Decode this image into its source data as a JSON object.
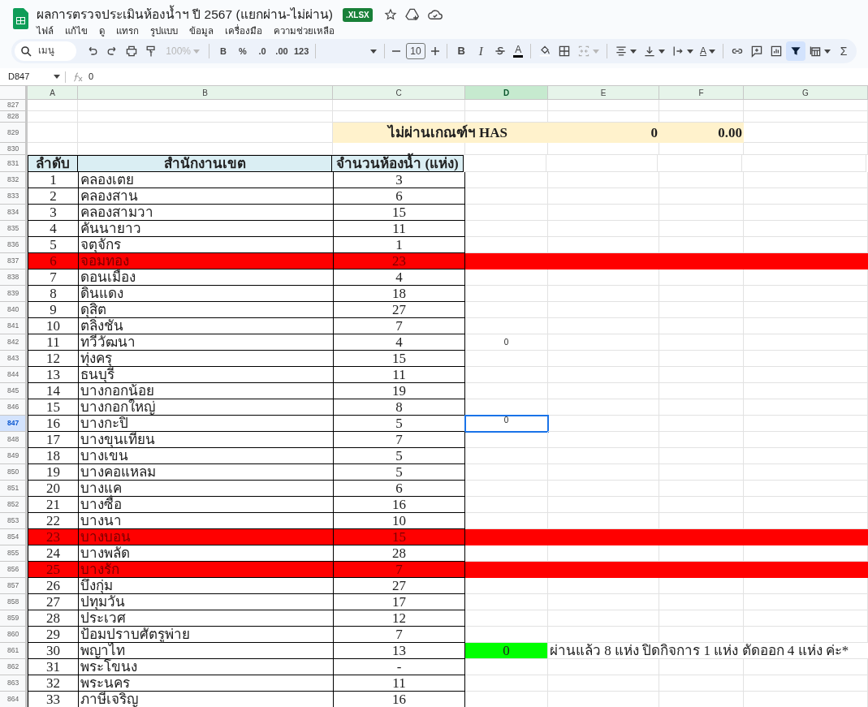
{
  "document": {
    "title": "ผลการตรวจประเมินห้องน้ำฯ ปี 2567 (แยกผ่าน-ไม่ผ่าน)",
    "badge": ".XLSX"
  },
  "menu": [
    "ไฟล์",
    "แก้ไข",
    "ดู",
    "แทรก",
    "รูปแบบ",
    "ข้อมูล",
    "เครื่องมือ",
    "ความช่วยเหลือ"
  ],
  "toolbar": [
    {
      "kind": "search",
      "label": "เมนู"
    },
    {
      "kind": "undo"
    },
    {
      "kind": "redo"
    },
    {
      "kind": "print"
    },
    {
      "kind": "paint_format"
    },
    {
      "kind": "zoom",
      "label": "100%",
      "disabled": true
    },
    {
      "kind": "sep"
    },
    {
      "kind": "text",
      "label": "B",
      "disabled": false
    },
    {
      "kind": "text",
      "label": "%",
      "disabled": false
    },
    {
      "kind": "text",
      "label": ".0",
      "disabled": false
    },
    {
      "kind": "text",
      "label": ".00",
      "disabled": false
    },
    {
      "kind": "text",
      "label": "123",
      "disabled": false
    },
    {
      "kind": "sep"
    },
    {
      "kind": "font"
    },
    {
      "kind": "sep"
    },
    {
      "kind": "minus"
    },
    {
      "kind": "font_size",
      "label": "10"
    },
    {
      "kind": "plus"
    },
    {
      "kind": "sep"
    },
    {
      "kind": "bold",
      "label": "B"
    },
    {
      "kind": "italic",
      "label": "I"
    },
    {
      "kind": "strike"
    },
    {
      "kind": "text_color",
      "label": "A"
    },
    {
      "kind": "sep"
    },
    {
      "kind": "fill"
    },
    {
      "kind": "borders"
    },
    {
      "kind": "merge",
      "disabled": true
    },
    {
      "kind": "sep"
    },
    {
      "kind": "align"
    },
    {
      "kind": "valign"
    },
    {
      "kind": "wrap"
    },
    {
      "kind": "rotate",
      "label": "A"
    },
    {
      "kind": "sep"
    },
    {
      "kind": "link"
    },
    {
      "kind": "comment"
    },
    {
      "kind": "chart"
    },
    {
      "kind": "filter",
      "selected": true
    },
    {
      "kind": "filter_views"
    },
    {
      "kind": "functions",
      "label": "Σ"
    }
  ],
  "formula_bar": {
    "cell": "D847",
    "value": "0"
  },
  "columns": [
    {
      "label": "A",
      "selected": false
    },
    {
      "label": "B",
      "selected": false
    },
    {
      "label": "C",
      "selected": false
    },
    {
      "label": "D",
      "selected": true
    },
    {
      "label": "E",
      "selected": false
    },
    {
      "label": "F",
      "selected": false
    },
    {
      "label": "G",
      "selected": false
    }
  ],
  "rows": [
    {
      "number": "827",
      "kind": "blank",
      "selected": false
    },
    {
      "number": "828",
      "kind": "blank",
      "selected": false
    },
    {
      "number": "829",
      "kind": "summary",
      "label": "ไม่ผ่านเกณฑ์ฯ HAS",
      "value": "0",
      "ratio": "0.00",
      "selected": false
    },
    {
      "number": "830",
      "kind": "blank",
      "selected": false
    },
    {
      "number": "831",
      "kind": "header",
      "cells": [
        "ลำดับ",
        "สำนักงานเขต",
        "จำนวนห้องน้ำ (แห่ง)"
      ],
      "selected": false
    },
    {
      "number": "832",
      "kind": "data",
      "order": "1",
      "name": "คลองเตย",
      "count": "3",
      "flagged": false,
      "selected": false
    },
    {
      "number": "833",
      "kind": "data",
      "order": "2",
      "name": "คลองสาน",
      "count": "6",
      "flagged": false,
      "selected": false
    },
    {
      "number": "834",
      "kind": "data",
      "order": "3",
      "name": "คลองสามวา",
      "count": "15",
      "flagged": false,
      "selected": false
    },
    {
      "number": "835",
      "kind": "data",
      "order": "4",
      "name": "คันนายาว",
      "count": "11",
      "flagged": false,
      "selected": false
    },
    {
      "number": "836",
      "kind": "data",
      "order": "5",
      "name": "จตุจักร",
      "count": "1",
      "flagged": false,
      "selected": false
    },
    {
      "number": "837",
      "kind": "data",
      "order": "6",
      "name": "จอมทอง",
      "count": "23",
      "flagged": true,
      "selected": false
    },
    {
      "number": "838",
      "kind": "data",
      "order": "7",
      "name": "ดอนเมือง",
      "count": "4",
      "flagged": false,
      "selected": false
    },
    {
      "number": "839",
      "kind": "data",
      "order": "8",
      "name": "ดินแดง",
      "count": "18",
      "flagged": false,
      "selected": false
    },
    {
      "number": "840",
      "kind": "data",
      "order": "9",
      "name": "ดุสิต",
      "count": "27",
      "flagged": false,
      "selected": false
    },
    {
      "number": "841",
      "kind": "data",
      "order": "10",
      "name": "ตลิ่งชัน",
      "count": "7",
      "flagged": false,
      "selected": false
    },
    {
      "number": "842",
      "kind": "data",
      "order": "11",
      "name": "ทวีวัฒนา",
      "count": "4",
      "flagged": false,
      "selected": false,
      "d": {
        "value": "0"
      }
    },
    {
      "number": "843",
      "kind": "data",
      "order": "12",
      "name": "ทุ่งครุ",
      "count": "15",
      "flagged": false,
      "selected": false
    },
    {
      "number": "844",
      "kind": "data",
      "order": "13",
      "name": "ธนบุรี",
      "count": "11",
      "flagged": false,
      "selected": false
    },
    {
      "number": "845",
      "kind": "data",
      "order": "14",
      "name": "บางกอกน้อย",
      "count": "19",
      "flagged": false,
      "selected": false
    },
    {
      "number": "846",
      "kind": "data",
      "order": "15",
      "name": "บางกอกใหญ่",
      "count": "8",
      "flagged": false,
      "selected": false
    },
    {
      "number": "847",
      "kind": "data",
      "order": "16",
      "name": "บางกะปิ",
      "count": "5",
      "flagged": false,
      "selected": true,
      "d": {
        "value": "0"
      }
    },
    {
      "number": "848",
      "kind": "data",
      "order": "17",
      "name": "บางขุนเทียน",
      "count": "7",
      "flagged": false,
      "selected": false
    },
    {
      "number": "849",
      "kind": "data",
      "order": "18",
      "name": "บางเขน",
      "count": "5",
      "flagged": false,
      "selected": false
    },
    {
      "number": "850",
      "kind": "data",
      "order": "19",
      "name": "บางคอแหลม",
      "count": "5",
      "flagged": false,
      "selected": false
    },
    {
      "number": "851",
      "kind": "data",
      "order": "20",
      "name": "บางแค",
      "count": "6",
      "flagged": false,
      "selected": false
    },
    {
      "number": "852",
      "kind": "data",
      "order": "21",
      "name": "บางซื่อ",
      "count": "16",
      "flagged": false,
      "selected": false
    },
    {
      "number": "853",
      "kind": "data",
      "order": "22",
      "name": "บางนา",
      "count": "10",
      "flagged": false,
      "selected": false
    },
    {
      "number": "854",
      "kind": "data",
      "order": "23",
      "name": "บางบอน",
      "count": "15",
      "flagged": true,
      "selected": false
    },
    {
      "number": "855",
      "kind": "data",
      "order": "24",
      "name": "บางพลัด",
      "count": "28",
      "flagged": false,
      "selected": false
    },
    {
      "number": "856",
      "kind": "data",
      "order": "25",
      "name": "บางรัก",
      "count": "7",
      "flagged": true,
      "selected": false
    },
    {
      "number": "857",
      "kind": "data",
      "order": "26",
      "name": "บึงกุ่ม",
      "count": "27",
      "flagged": false,
      "selected": false
    },
    {
      "number": "858",
      "kind": "data",
      "order": "27",
      "name": "ปทุมวัน",
      "count": "17",
      "flagged": false,
      "selected": false
    },
    {
      "number": "859",
      "kind": "data",
      "order": "28",
      "name": "ประเวศ",
      "count": "12",
      "flagged": false,
      "selected": false
    },
    {
      "number": "860",
      "kind": "data",
      "order": "29",
      "name": "ป้อมปราบศัตรูพ่าย",
      "count": "7",
      "flagged": false,
      "selected": false
    },
    {
      "number": "861",
      "kind": "data",
      "order": "30",
      "name": "พญาไท",
      "count": "13",
      "flagged": false,
      "selected": false,
      "d": {
        "value": "0",
        "color": "#00ff00"
      },
      "note": "ผ่านแล้ว 8 แห่ง ปิดกิจการ 1 แห่ง ตัดออก 4 แห่ง ค่ะ*"
    },
    {
      "number": "862",
      "kind": "data",
      "order": "31",
      "name": "พระโขนง",
      "count": "-",
      "flagged": false,
      "selected": false
    },
    {
      "number": "863",
      "kind": "data",
      "order": "32",
      "name": "พระนคร",
      "count": "11",
      "flagged": false,
      "selected": false
    },
    {
      "number": "864",
      "kind": "data",
      "order": "33",
      "name": "ภาษีเจริญ",
      "count": "16",
      "flagged": false,
      "selected": false
    }
  ]
}
